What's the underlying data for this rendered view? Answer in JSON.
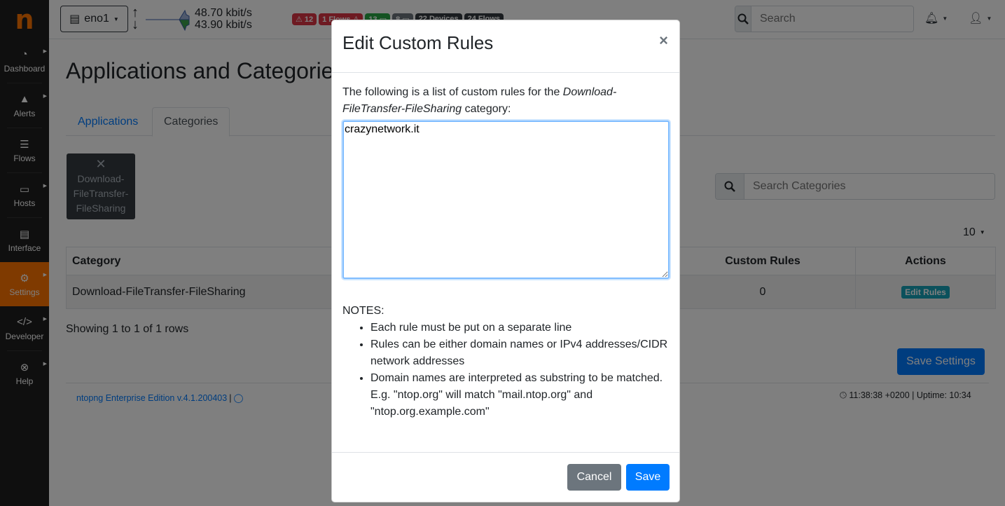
{
  "sidebar": {
    "logo": "n",
    "items": [
      {
        "label": "Dashboard",
        "icon": "dashboard-gauge-icon",
        "glyph": "◔",
        "has_submenu": true,
        "active": false
      },
      {
        "label": "Alerts",
        "icon": "warning-icon",
        "glyph": "▲",
        "has_submenu": true,
        "active": false
      },
      {
        "label": "Flows",
        "icon": "flows-icon",
        "glyph": "☰",
        "has_submenu": false,
        "active": false
      },
      {
        "label": "Hosts",
        "icon": "laptop-icon",
        "glyph": "▭",
        "has_submenu": true,
        "active": false
      },
      {
        "label": "Interface",
        "icon": "ethernet-icon",
        "glyph": "▤",
        "has_submenu": false,
        "active": false
      },
      {
        "label": "Settings",
        "icon": "gear-icon",
        "glyph": "⚙",
        "has_submenu": true,
        "active": true
      },
      {
        "label": "Developer",
        "icon": "code-icon",
        "glyph": "</>",
        "has_submenu": true,
        "active": false
      },
      {
        "label": "Help",
        "icon": "lifebuoy-icon",
        "glyph": "⊗",
        "has_submenu": true,
        "active": false
      }
    ]
  },
  "topbar": {
    "interface": "eno1",
    "rate_up": "48.70 kbit/s",
    "rate_down": "43.90 kbit/s",
    "badges": [
      {
        "text": "⚠ 12",
        "color": "#dc3545"
      },
      {
        "text": "1 Flows ⚠",
        "color": "#dc3545"
      },
      {
        "text": "13 ▭",
        "color": "#28a745"
      },
      {
        "text": "8 ▭",
        "color": "#6c757d"
      },
      {
        "text": "22 Devices",
        "color": "#343a40"
      },
      {
        "text": "24 Flows",
        "color": "#343a40"
      }
    ],
    "search_placeholder": "Search"
  },
  "main": {
    "title": "Applications and Categories",
    "tabs": [
      {
        "label": "Applications",
        "active": false
      },
      {
        "label": "Categories",
        "active": true
      }
    ],
    "filter_chip": {
      "line1": "Download-",
      "line2": "FileTransfer-",
      "line3": "FileSharing"
    },
    "search_placeholder": "Search Categories",
    "page_size": "10",
    "table": {
      "headers": {
        "category": "Category",
        "custom_rules": "Custom Rules",
        "actions": "Actions"
      },
      "rows": [
        {
          "category": "Download-FileTransfer-FileSharing",
          "custom_rules": "0",
          "action": "Edit Rules"
        }
      ]
    },
    "showing": "Showing 1 to 1 of 1 rows",
    "save_settings": "Save Settings"
  },
  "footer": {
    "edition": "ntopng Enterprise Edition v.4.1.200403",
    "separator": "|",
    "clock": "11:38:38 +0200 | Uptime: 10:34"
  },
  "modal": {
    "title": "Edit Custom Rules",
    "intro_prefix": "The following is a list of custom rules for the ",
    "category_name": "Download-FileTransfer-FileSharing",
    "intro_suffix": " category:",
    "rules_value": "crazynetwork.it",
    "notes_label": "NOTES:",
    "notes": [
      "Each rule must be put on a separate line",
      "Rules can be either domain names or IPv4 addresses/CIDR network addresses",
      "Domain names are interpreted as substring to be matched."
    ],
    "note_example": "E.g. \"ntop.org\" will match \"mail.ntop.org\" and \"ntop.org.example.com\"",
    "cancel": "Cancel",
    "save": "Save"
  }
}
